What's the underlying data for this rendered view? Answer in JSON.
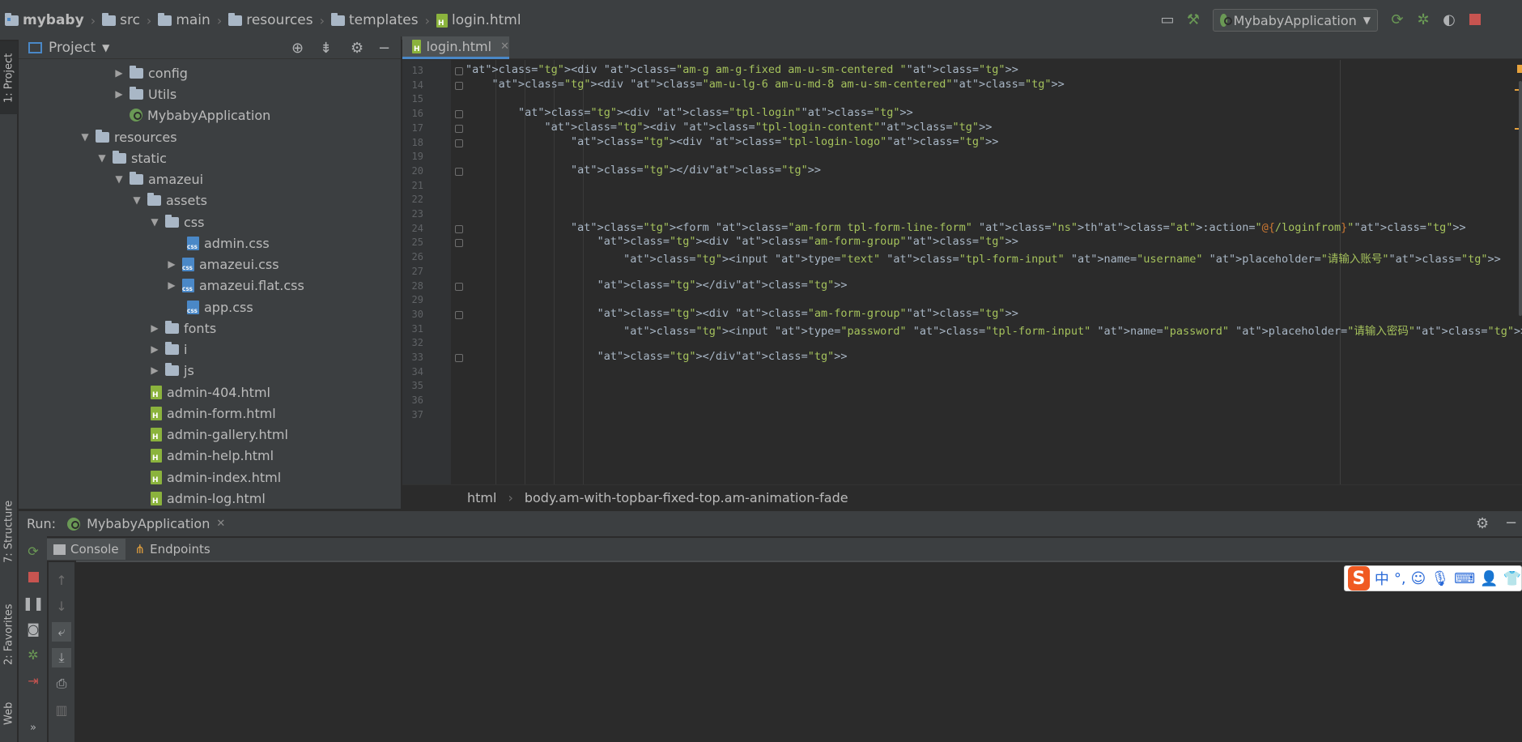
{
  "breadcrumb": {
    "project": "mybaby",
    "items": [
      "src",
      "main",
      "resources",
      "templates"
    ],
    "file": "login.html"
  },
  "toolbar": {
    "run_config": "MybabyApplication"
  },
  "left_strip": {
    "project_tab": "1: Project",
    "structure_tab": "7: Structure",
    "favorites_tab": "2: Favorites",
    "web_tab": "Web"
  },
  "project_panel": {
    "title": "Project",
    "tree": [
      {
        "label": "config",
        "type": "folder",
        "level": 5,
        "arrow": "right"
      },
      {
        "label": "Utils",
        "type": "folder",
        "level": 5,
        "arrow": "right"
      },
      {
        "label": "MybabyApplication",
        "type": "spring",
        "level": 5,
        "arrow": ""
      },
      {
        "label": "resources",
        "type": "folder",
        "level": 3,
        "arrow": "down"
      },
      {
        "label": "static",
        "type": "folder",
        "level": 4,
        "arrow": "down"
      },
      {
        "label": "amazeui",
        "type": "folder",
        "level": 5,
        "arrow": "down"
      },
      {
        "label": "assets",
        "type": "folder",
        "level": 6,
        "arrow": "down"
      },
      {
        "label": "css",
        "type": "folder",
        "level": 7,
        "arrow": "down"
      },
      {
        "label": "admin.css",
        "type": "css",
        "level": 9,
        "arrow": ""
      },
      {
        "label": "amazeui.css",
        "type": "css",
        "level": 9,
        "arrow": "right"
      },
      {
        "label": "amazeui.flat.css",
        "type": "css",
        "level": 9,
        "arrow": "right"
      },
      {
        "label": "app.css",
        "type": "css",
        "level": 9,
        "arrow": ""
      },
      {
        "label": "fonts",
        "type": "folder",
        "level": 7,
        "arrow": "right"
      },
      {
        "label": "i",
        "type": "folder",
        "level": 7,
        "arrow": "right"
      },
      {
        "label": "js",
        "type": "folder",
        "level": 7,
        "arrow": "right"
      },
      {
        "label": "admin-404.html",
        "type": "html",
        "level": 7,
        "arrow": ""
      },
      {
        "label": "admin-form.html",
        "type": "html",
        "level": 7,
        "arrow": ""
      },
      {
        "label": "admin-gallery.html",
        "type": "html",
        "level": 7,
        "arrow": ""
      },
      {
        "label": "admin-help.html",
        "type": "html",
        "level": 7,
        "arrow": ""
      },
      {
        "label": "admin-index.html",
        "type": "html",
        "level": 7,
        "arrow": ""
      },
      {
        "label": "admin-log.html",
        "type": "html",
        "level": 7,
        "arrow": ""
      }
    ]
  },
  "editor": {
    "tab_label": "login.html",
    "line_numbers": [
      "13",
      "14",
      "15",
      "16",
      "17",
      "18",
      "19",
      "20",
      "21",
      "22",
      "23",
      "24",
      "25",
      "26",
      "27",
      "28",
      "29",
      "30",
      "31",
      "32",
      "33",
      "34",
      "35",
      "36",
      "37"
    ],
    "lines": [
      "<div class=\"am-g am-g-fixed am-u-sm-centered \">",
      "    <div class=\"am-u-lg-6 am-u-md-8 am-u-sm-centered\">",
      "",
      "        <div class=\"tpl-login\">",
      "            <div class=\"tpl-login-content\">",
      "                <div class=\"tpl-login-logo\">",
      "",
      "                </div>",
      "",
      "",
      "",
      "                <form class=\"am-form tpl-form-line-form\" th:action=\"@{/loginfrom}\">",
      "                    <div class=\"am-form-group\">",
      "                        <input type=\"text\" class=\"tpl-form-input\" name=\"username\" placeholder=\"请输入账号\">",
      "",
      "                    </div>",
      "",
      "                    <div class=\"am-form-group\">",
      "                        <input type=\"password\" class=\"tpl-form-input\" name=\"password\" placeholder=\"请输入密码\">",
      "",
      "                    </div>",
      "",
      "",
      "",
      ""
    ],
    "path_crumbs": [
      "html",
      "body.am-with-topbar-fixed-top.am-animation-fade"
    ]
  },
  "run_panel": {
    "label": "Run:",
    "config_tab": "MybabyApplication",
    "tabs": [
      "Console",
      "Endpoints"
    ]
  },
  "ime_toolbar": {
    "logo": "S",
    "mode": "中",
    "punct": "°,"
  },
  "colors": {
    "tag": "#e8bf6a",
    "attr_value": "#a5c25c",
    "accent": "#4a88c7"
  }
}
